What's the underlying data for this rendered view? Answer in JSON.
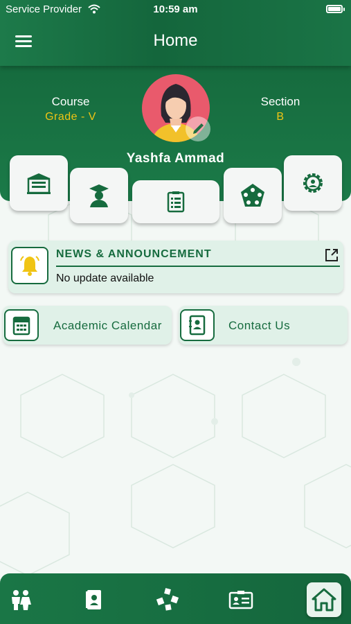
{
  "status_bar": {
    "carrier": "Service Provider",
    "time": "10:59 am"
  },
  "header": {
    "title": "Home"
  },
  "profile": {
    "course_label": "Course",
    "course_value": "Grade - V",
    "section_label": "Section",
    "section_value": "B",
    "name": "Yashfa Ammad"
  },
  "quick_tiles": [
    {
      "icon": "school-building-icon"
    },
    {
      "icon": "graduate-icon"
    },
    {
      "icon": "report-card-icon"
    },
    {
      "icon": "team-icon"
    },
    {
      "icon": "settings-icon"
    }
  ],
  "news": {
    "title": "NEWS & ANNOUNCEMENT",
    "text": "No update available"
  },
  "shortcuts": [
    {
      "label": "Academic Calendar",
      "icon": "calendar-icon"
    },
    {
      "label": "Contact Us",
      "icon": "contact-book-icon"
    }
  ],
  "bottom_nav": [
    {
      "icon": "children-icon"
    },
    {
      "icon": "book-icon"
    },
    {
      "icon": "activities-icon"
    },
    {
      "icon": "id-card-icon"
    },
    {
      "icon": "home-icon"
    }
  ],
  "colors": {
    "primary": "#166b3e",
    "accent": "#f0c414",
    "avatar_bg": "#e95a6c",
    "card_bg": "#e0f1e8"
  }
}
